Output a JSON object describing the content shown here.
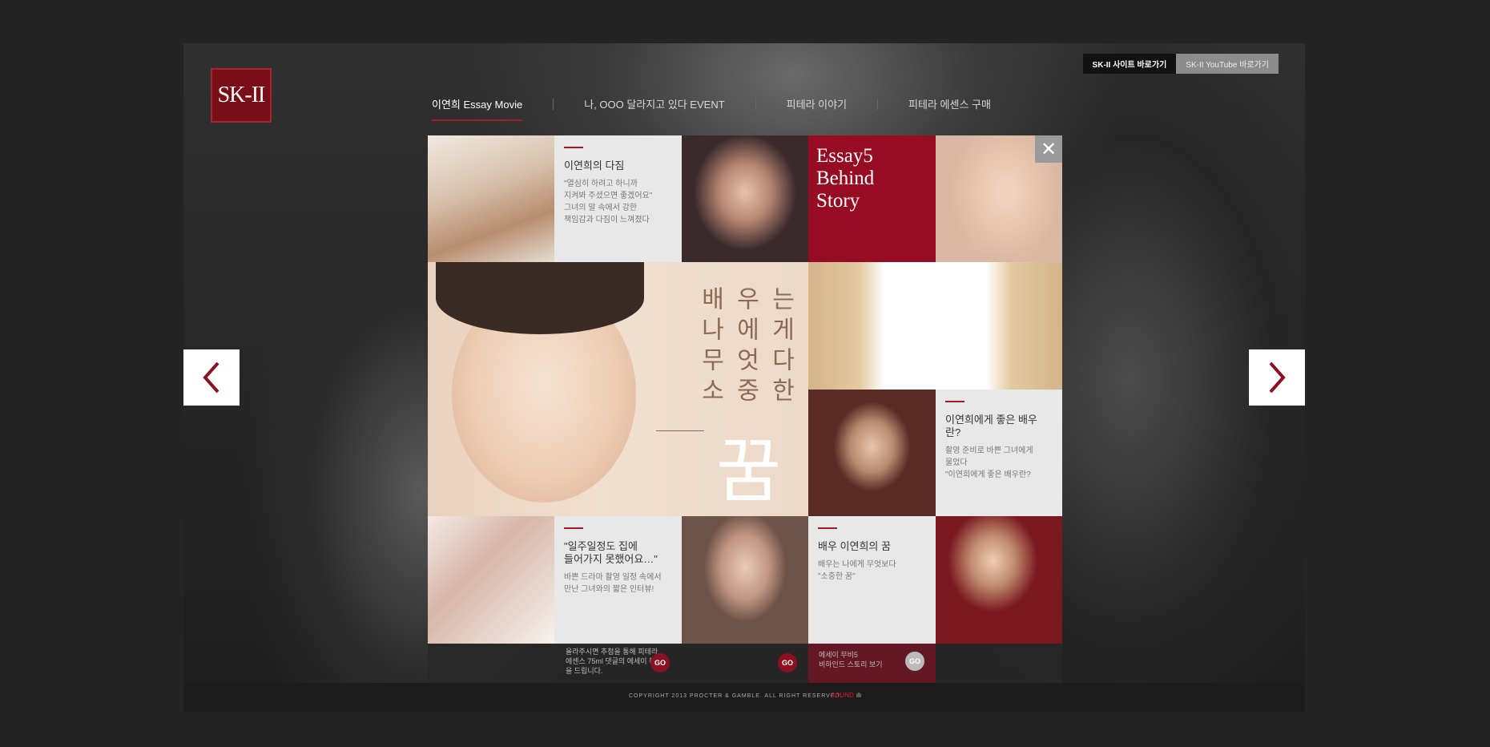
{
  "brand": {
    "logo": "SK-II"
  },
  "toplinks": [
    "SK-II 사이트 바로가기",
    "SK-II YouTube 바로가기"
  ],
  "nav": [
    "이연희 Essay Movie",
    "나, OOO 달라지고 있다 EVENT",
    "피테라 이야기",
    "피테라 에센스 구매"
  ],
  "tiles": {
    "t1": {
      "title": "이연희의 다짐",
      "body": "\"열심히 하려고 하니까\n지켜봐 주셨으면 좋겠어요\"\n그녀의 말 속에서 강한\n책임감과 다짐이 느껴졌다"
    },
    "essay": "Essay5\nBehind\nStory",
    "hero": {
      "col1": "배나무소",
      "col2": "우에엇중",
      "col3": "는게다한",
      "dream": "꿈"
    },
    "t2": {
      "title": "이연희에게 좋은 배우란?",
      "body": "촬영 준비로 바쁜 그녀에게\n물었다\n\"이연희에게 좋은 배우란?"
    },
    "t3": {
      "title": "\"일주일정도 집에\n들어가지 못했어요…\"",
      "body": "바쁜 드라마 촬영 일정 속에서\n만난 그녀와의 짧은 인터뷰!"
    },
    "t4": {
      "title": "배우 이연희의 꿈",
      "body": "배우는 나에게 무엇보다\n\"소중한 꿈\""
    }
  },
  "strip": {
    "c1": "올라주시면 추첨을 통해 피테라\n에센스 75ml 댓글의 에세이 북\n을 드립니다.",
    "c2": "에세이 무비5\n비하인드 스토리 보기",
    "go": "GO"
  },
  "footer": {
    "copyright": "COPYRIGHT 2013 PROCTER & GAMBLE. ALL RIGHT RESERVED.",
    "sound": "SOUND"
  }
}
